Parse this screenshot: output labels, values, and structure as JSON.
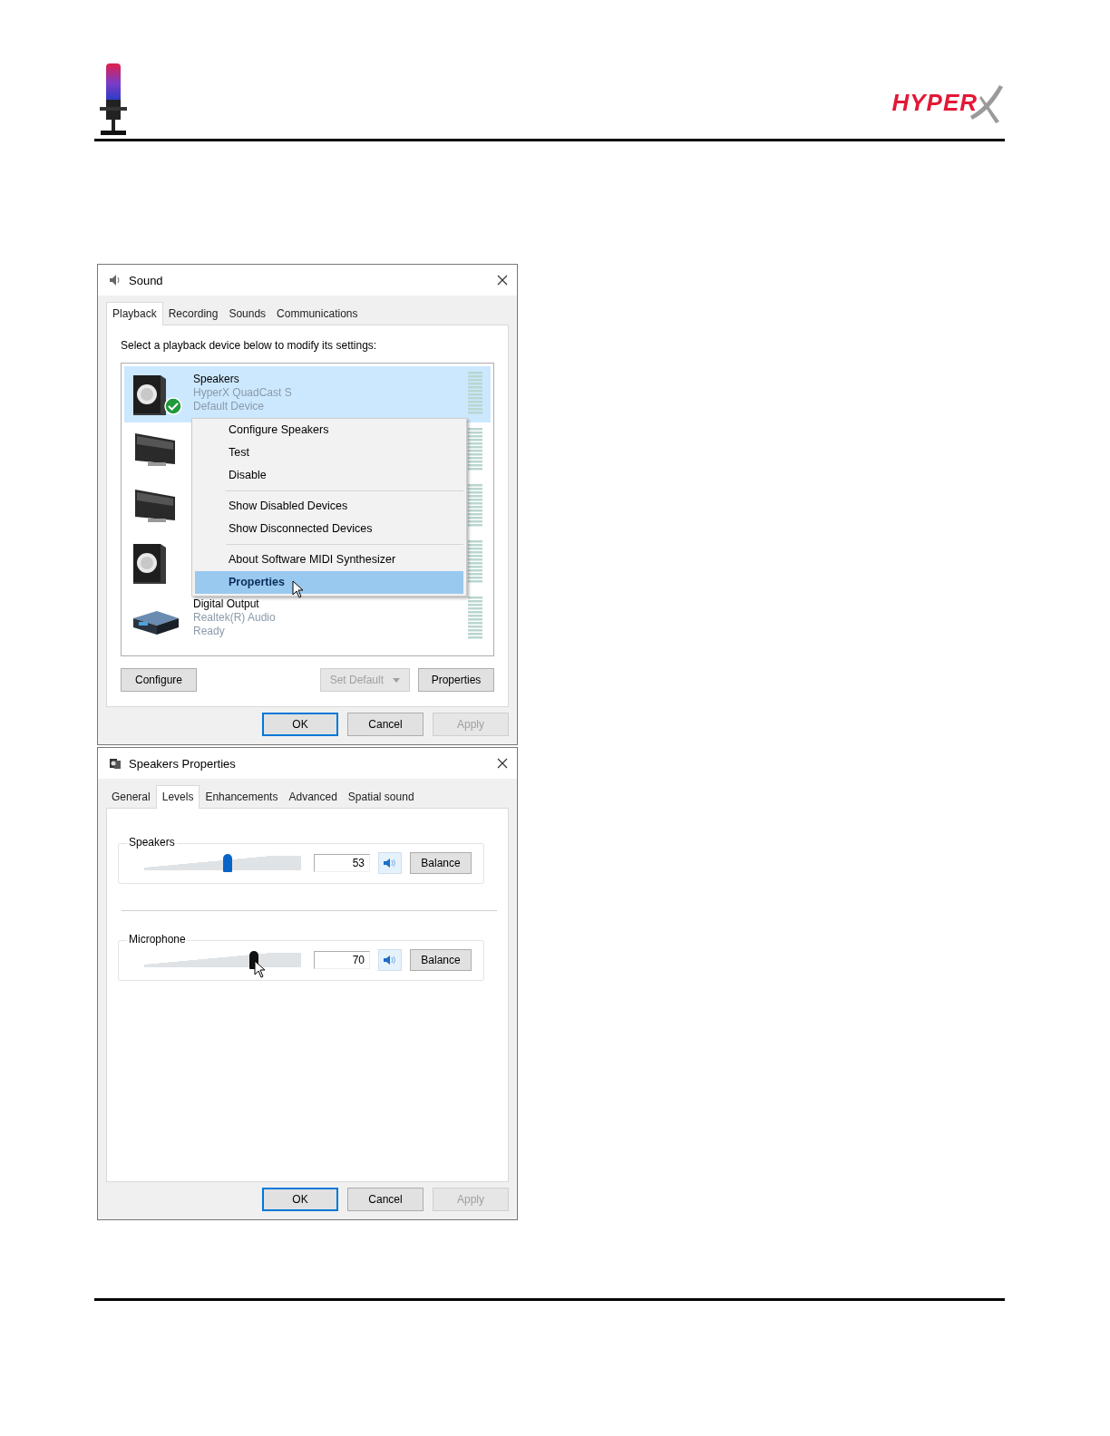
{
  "header": {
    "logo": "HYPER"
  },
  "sound_dialog": {
    "title": "Sound",
    "tabs": [
      {
        "label": "Playback",
        "selected": true
      },
      {
        "label": "Recording",
        "selected": false
      },
      {
        "label": "Sounds",
        "selected": false
      },
      {
        "label": "Communications",
        "selected": false
      }
    ],
    "instruction": "Select a playback device below to modify its settings:",
    "devices": [
      {
        "kind": "speaker",
        "selected": true,
        "default": true,
        "name": "Speakers",
        "detail": "HyperX QuadCast S",
        "status": "Default Device"
      },
      {
        "kind": "monitor",
        "selected": false,
        "default": false
      },
      {
        "kind": "monitor",
        "selected": false,
        "default": false
      },
      {
        "kind": "speaker",
        "selected": false,
        "default": false
      },
      {
        "kind": "digital",
        "selected": false,
        "default": false,
        "name": "Digital Output",
        "detail": "Realtek(R) Audio",
        "status": "Ready"
      }
    ],
    "context_menu": [
      {
        "label": "Configure Speakers",
        "selected": false,
        "separator_before": false
      },
      {
        "label": "Test",
        "selected": false,
        "separator_before": false
      },
      {
        "label": "Disable",
        "selected": false,
        "separator_before": false
      },
      {
        "label": "Show Disabled Devices",
        "selected": false,
        "separator_before": true
      },
      {
        "label": "Show Disconnected Devices",
        "selected": false,
        "separator_before": false
      },
      {
        "label": "About Software MIDI Synthesizer",
        "selected": false,
        "separator_before": true
      },
      {
        "label": "Properties",
        "selected": true,
        "separator_before": false
      }
    ],
    "device_buttons": [
      {
        "label": "Configure",
        "kind": "plain",
        "disabled": false
      },
      {
        "label": "Set Default",
        "kind": "split",
        "disabled": true
      },
      {
        "label": "Properties",
        "kind": "plain",
        "disabled": false
      }
    ],
    "dialog_buttons": [
      {
        "label": "OK",
        "default": true,
        "disabled": false
      },
      {
        "label": "Cancel",
        "default": false,
        "disabled": false
      },
      {
        "label": "Apply",
        "default": false,
        "disabled": true
      }
    ]
  },
  "properties_dialog": {
    "title": "Speakers Properties",
    "tabs": [
      {
        "label": "General",
        "selected": false
      },
      {
        "label": "Levels",
        "selected": true
      },
      {
        "label": "Enhancements",
        "selected": false
      },
      {
        "label": "Advanced",
        "selected": false
      },
      {
        "label": "Spatial sound",
        "selected": false
      }
    ],
    "levels": [
      {
        "label": "Speakers",
        "level": 0.53,
        "reading": "53",
        "balance": "Balance"
      },
      {
        "label": "Microphone",
        "level": 0.7,
        "reading": "70",
        "balance": "Balance"
      }
    ],
    "dialog_buttons": [
      {
        "label": "OK",
        "default": true,
        "disabled": false
      },
      {
        "label": "Cancel",
        "default": false,
        "disabled": false
      },
      {
        "label": "Apply",
        "default": false,
        "disabled": true
      }
    ]
  }
}
